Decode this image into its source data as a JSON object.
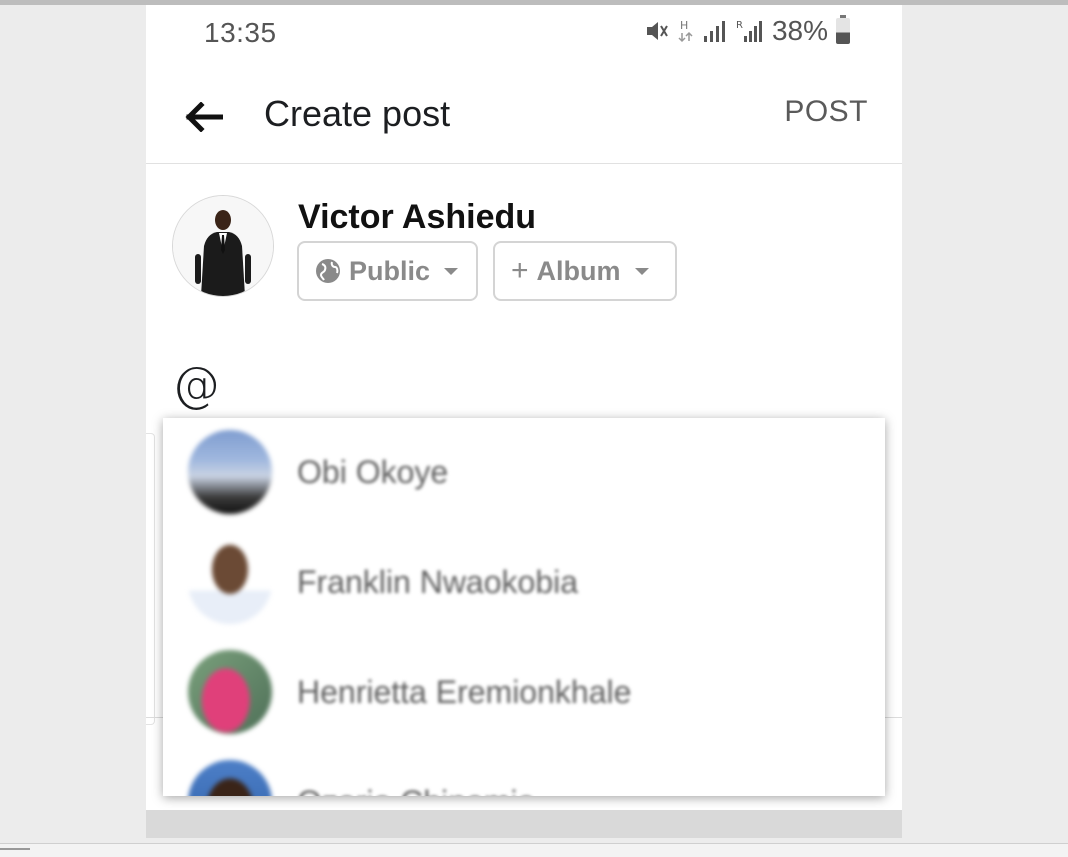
{
  "status_bar": {
    "time": "13:35",
    "battery_percent": "38%"
  },
  "app_bar": {
    "title": "Create post",
    "post_label": "POST"
  },
  "author": {
    "name": "Victor Ashiedu",
    "privacy_label": "Public",
    "album_label": "Album"
  },
  "composer": {
    "text": "@"
  },
  "mention_suggestions": [
    {
      "name": "Obi Okoye"
    },
    {
      "name": "Franklin Nwaokobia"
    },
    {
      "name": "Henrietta Eremionkhale"
    },
    {
      "name": "Ozoria Chinemia"
    }
  ],
  "colors": {
    "text_primary": "#1c1e21",
    "text_secondary": "#8a8a8a",
    "divider": "#e1e1e1"
  }
}
